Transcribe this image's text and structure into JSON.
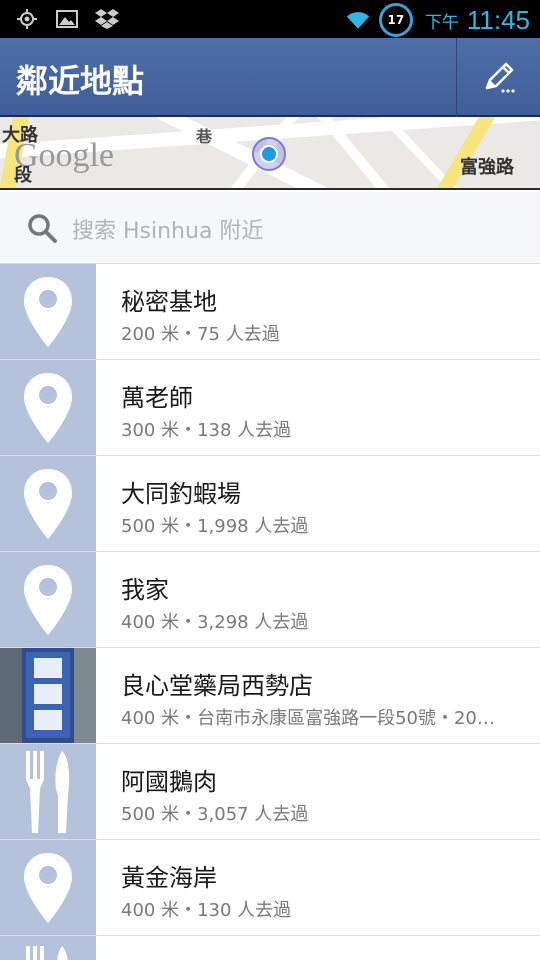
{
  "statusbar": {
    "ampm": "下午",
    "time": "11:45",
    "battery": "17"
  },
  "actionbar": {
    "title": "鄰近地點"
  },
  "map": {
    "logo": "Google",
    "labels": [
      "大路",
      "段",
      "巷",
      "富強路"
    ]
  },
  "search": {
    "placeholder": "搜索 Hsinhua 附近"
  },
  "places": [
    {
      "name": "秘密基地",
      "sub": "200 米・75 人去過",
      "icon": "map-pin-icon"
    },
    {
      "name": "萬老師",
      "sub": "300 米・138 人去過",
      "icon": "map-pin-icon"
    },
    {
      "name": "大同釣蝦場",
      "sub": "500 米・1,998 人去過",
      "icon": "map-pin-icon"
    },
    {
      "name": "我家",
      "sub": "400 米・3,298 人去過",
      "icon": "map-pin-icon"
    },
    {
      "name": "良心堂藥局西勢店",
      "sub": "400 米・台南市永康區富強路一段50號・20…",
      "icon": "photo"
    },
    {
      "name": "阿國鵝肉",
      "sub": "500 米・3,057 人去過",
      "icon": "fork-knife-icon"
    },
    {
      "name": "黃金海岸",
      "sub": "400 米・130 人去過",
      "icon": "map-pin-icon"
    }
  ],
  "colors": {
    "actionbar": "#4a67a2",
    "thumb": "#b4c2dc",
    "accent": "#33b5e5"
  }
}
